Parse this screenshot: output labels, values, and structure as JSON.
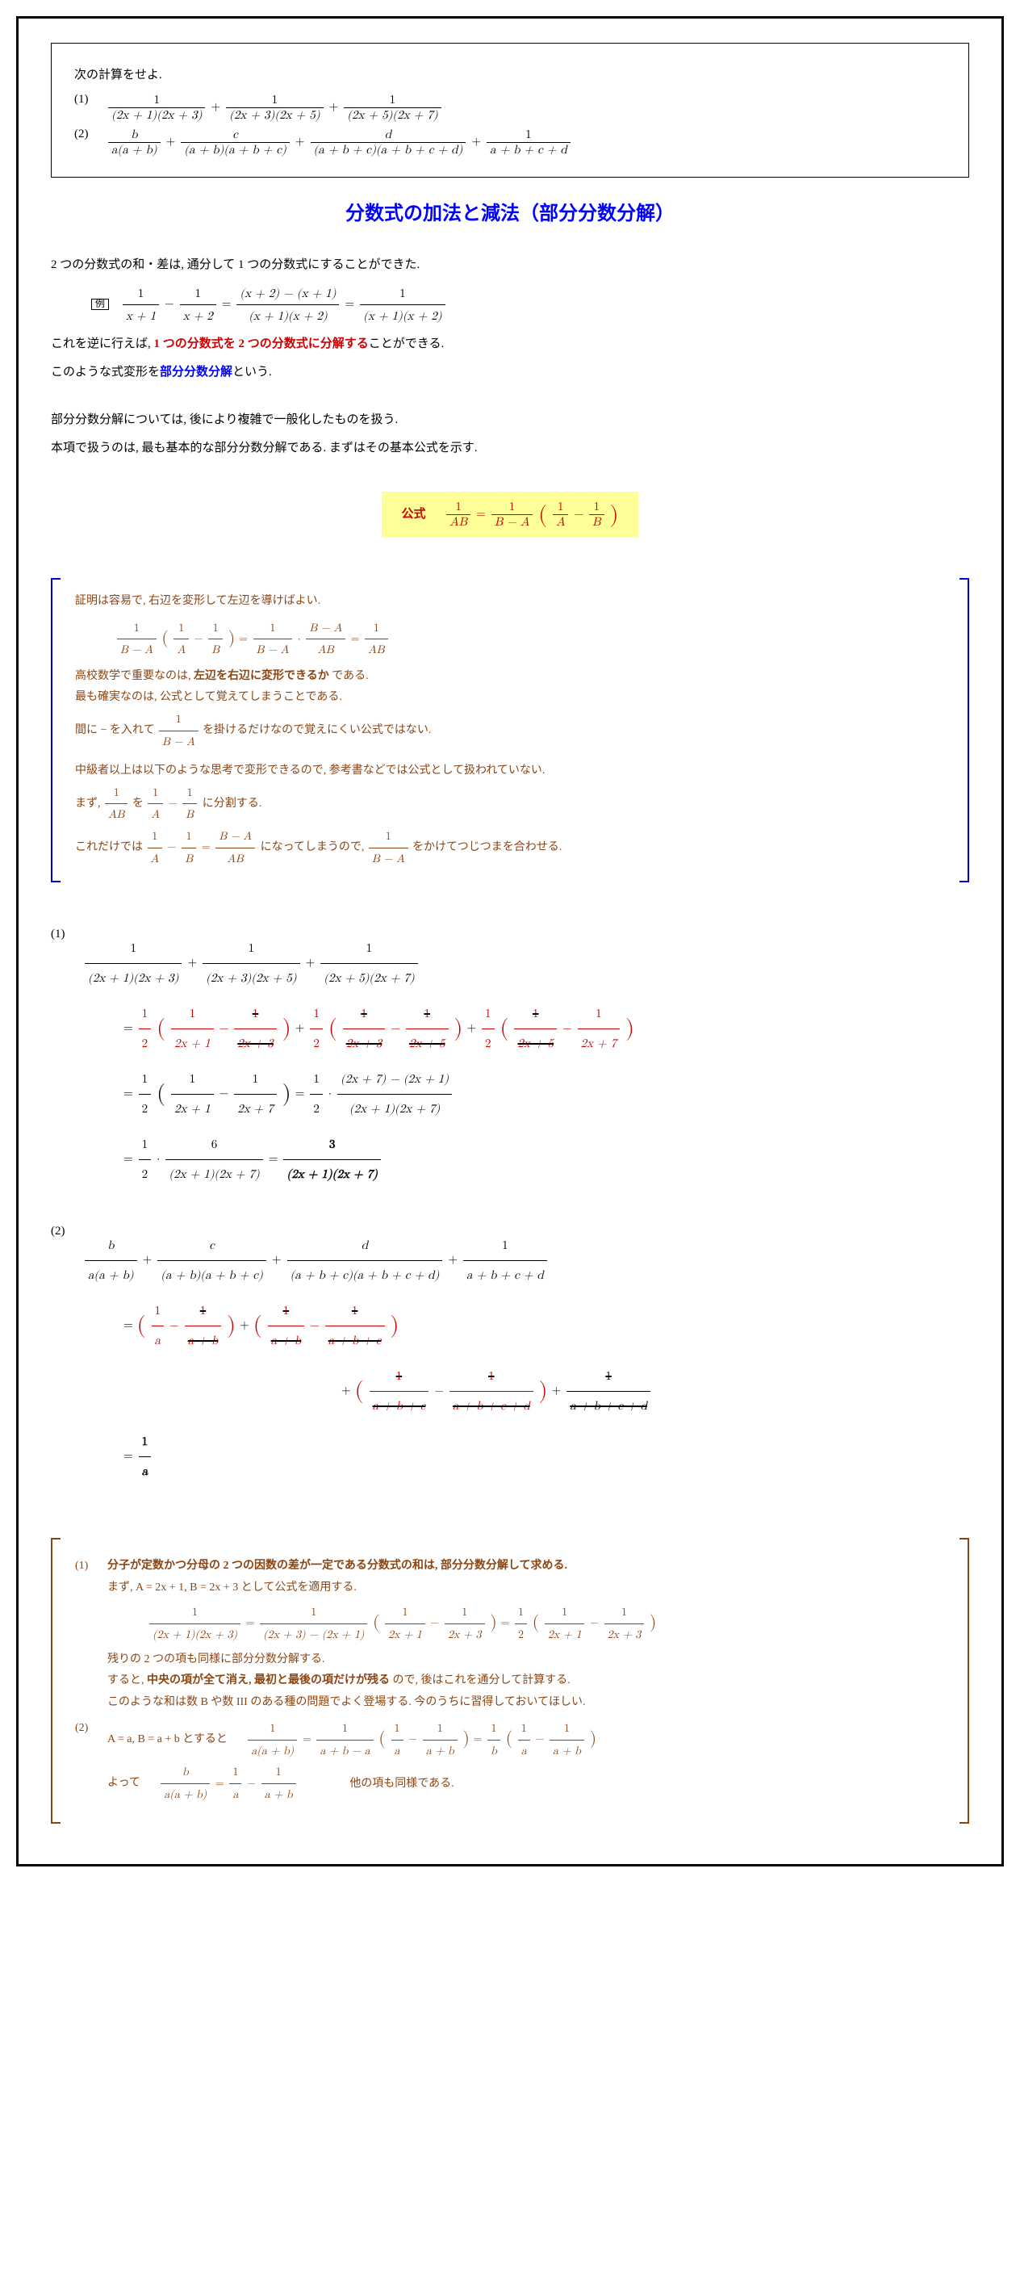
{
  "problem": {
    "intro": "次の計算をせよ.",
    "items": [
      "(1)",
      "(2)"
    ]
  },
  "title": "分数式の加法と減法（部分分数分解）",
  "explain": {
    "line1_pre": "2 つの分数式の和・差は, 通分して 1 つの分数式にすることができた.",
    "example_label": "例",
    "line2_pre": "これを逆に行えば, ",
    "line2_red": "1 つの分数式を 2 つの分数式に分解する",
    "line2_post": "ことができる.",
    "line3_pre": "このような式変形を",
    "line3_blue": "部分分数分解",
    "line3_post": "という.",
    "line4": "部分分数分解については, 後により複雑で一般化したものを扱う.",
    "line5": "本項で扱うのは, 最も基本的な部分分数分解である. まずはその基本公式を示す."
  },
  "formula": {
    "label": "公式"
  },
  "proof": {
    "l1": "証明は容易で, 右辺を変形して左辺を導けばよい.",
    "l2_pre": "高校数学で重要なのは, ",
    "l2_bold": "左辺を右辺に変形できるか",
    "l2_post": " である.",
    "l3": "最も確実なのは, 公式として覚えてしまうことである.",
    "l4_pre": "間に − を入れて ",
    "l4_post": " を掛けるだけなので覚えにくい公式ではない.",
    "l5": "中級者以上は以下のような思考で変形できるので, 参考書などでは公式として扱われていない.",
    "l6_pre": "まず, ",
    "l6_mid": " を ",
    "l6_post": " に分割する.",
    "l7_pre": "これだけでは ",
    "l7_mid": " になってしまうので, ",
    "l7_post": " をかけてつじつまを合わせる."
  },
  "notes": {
    "l1_bold": "分子が定数かつ分母の 2 つの因数の差が一定である分数式の和は, 部分分数分解して求める.",
    "l2": "まず, A = 2x + 1, B = 2x + 3 として公式を適用する.",
    "l3": "残りの 2 つの項も同様に部分分数分解する.",
    "l4_pre": "すると, ",
    "l4_bold": "中央の項が全て消え, 最初と最後の項だけが残る",
    "l4_post": " ので, 後はこれを通分して計算する.",
    "l5": "このような和は数 B や数 III のある種の問題でよく登場する. 今のうちに習得しておいてほしい.",
    "l6_pre": "A = a, B = a + b とすると",
    "l7_pre": "よって",
    "l7_post": "他の項も同様である."
  }
}
